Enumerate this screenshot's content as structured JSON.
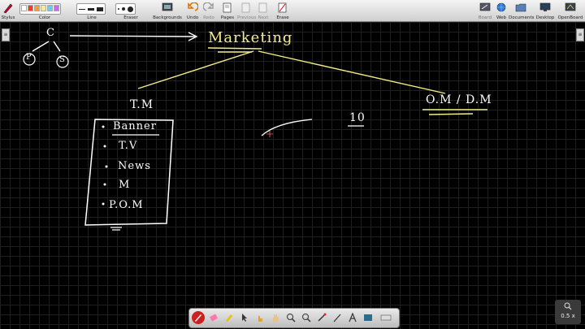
{
  "toolbar": {
    "stylus": "Stylus",
    "color": "Color",
    "line": "Line",
    "eraser": "Eraser",
    "backgrounds": "Backgrounds",
    "undo": "Undo",
    "redo": "Redo",
    "pages": "Pages",
    "previous": "Previous",
    "next": "Next",
    "erase": "Erase",
    "board": "Board",
    "web": "Web",
    "documents": "Documents",
    "desktop": "Desktop",
    "openboard": "OpenBoard"
  },
  "colors": {
    "swatches": [
      "#ffffff",
      "#ff3333",
      "#ff9933",
      "#f4ee86",
      "#66ccff",
      "#cc66ff"
    ],
    "ink_white": "#ffffff",
    "ink_yellow": "#f4ee86"
  },
  "board": {
    "c_node": "C",
    "p_node": "P",
    "s_node": "S",
    "title": "Marketing",
    "tm": "T.M",
    "om_dm": "O.M / D.M",
    "ten": "10",
    "list": [
      "Banner",
      "T.V",
      "News",
      "M",
      "P.O.M"
    ]
  },
  "zoom": {
    "value": "0.5 x"
  },
  "side": {
    "left_tab": "≡",
    "right_tab": "≡"
  }
}
